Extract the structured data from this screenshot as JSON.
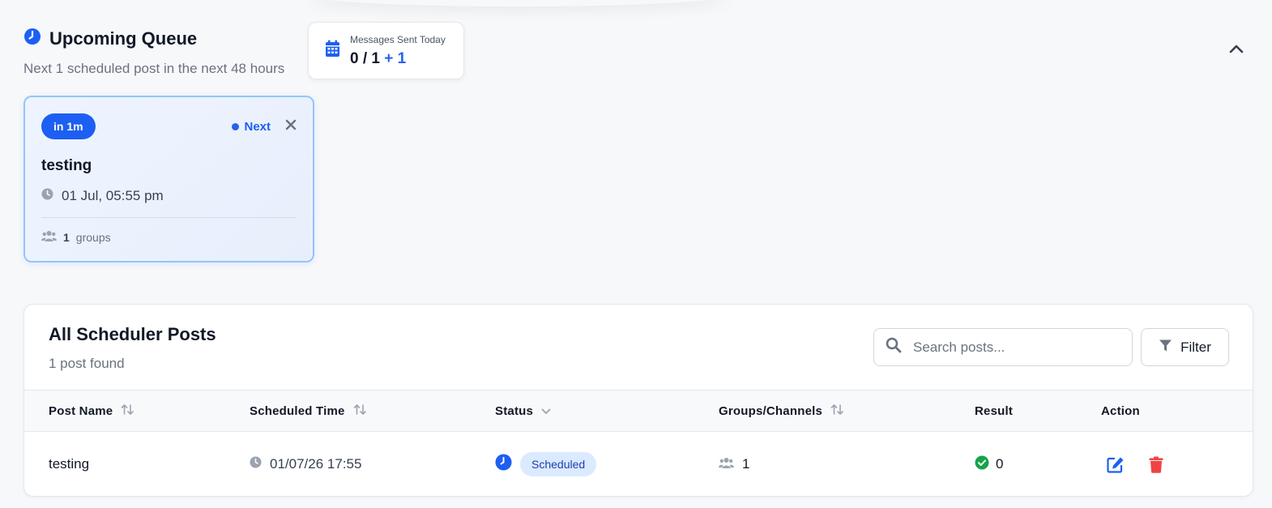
{
  "queue": {
    "title": "Upcoming Queue",
    "subtitle": "Next 1 scheduled post in the next 48 hours",
    "stats": {
      "label": "Messages Sent Today",
      "value": "0 / 1",
      "plus": "+ 1"
    },
    "items": [
      {
        "eta": "in 1m",
        "badge": "Next",
        "title": "testing",
        "time": "01 Jul, 05:55 pm",
        "groups_count": "1",
        "groups_label": "groups"
      }
    ]
  },
  "posts": {
    "title": "All Scheduler Posts",
    "count_text": "1 post found",
    "search_placeholder": "Search posts...",
    "filter_label": "Filter",
    "columns": [
      "Post Name",
      "Scheduled Time",
      "Status",
      "Groups/Channels",
      "Result",
      "Action"
    ],
    "rows": [
      {
        "name": "testing",
        "scheduled": "01/07/26 17:55",
        "status": "Scheduled",
        "groups": "1",
        "result": "0"
      }
    ]
  },
  "colors": {
    "accent": "#1d5ff3",
    "danger": "#ef4444",
    "success": "#16a34a",
    "muted": "#9ca3af"
  }
}
